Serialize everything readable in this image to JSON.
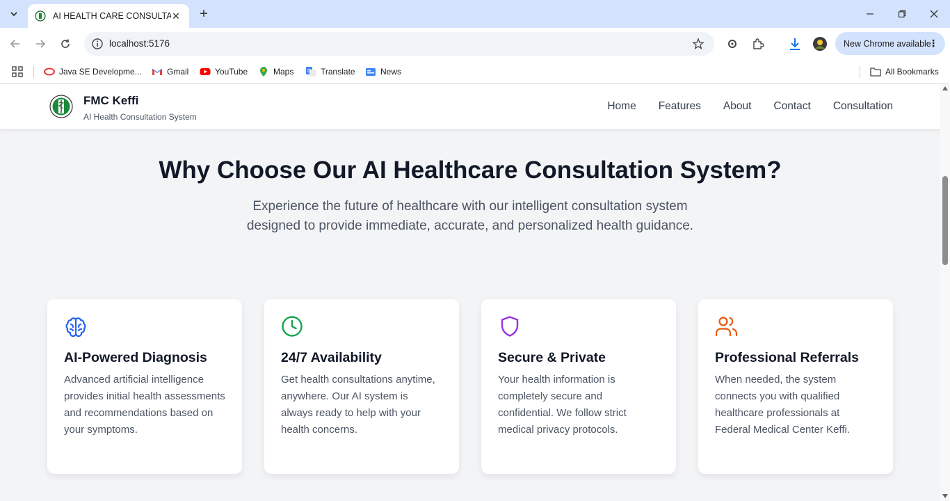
{
  "browser": {
    "tab_title": "AI HEALTH CARE CONSULTATIO",
    "url": "localhost:5176",
    "update_label": "New Chrome available",
    "bookmarks": [
      {
        "label": "Java SE Developme...",
        "icon": "oracle-icon"
      },
      {
        "label": "Gmail",
        "icon": "gmail-icon"
      },
      {
        "label": "YouTube",
        "icon": "youtube-icon"
      },
      {
        "label": "Maps",
        "icon": "maps-icon"
      },
      {
        "label": "Translate",
        "icon": "translate-icon"
      },
      {
        "label": "News",
        "icon": "news-icon"
      }
    ],
    "all_bookmarks": "All Bookmarks"
  },
  "header": {
    "brand": "FMC Keffi",
    "tagline": "AI Health Consultation System",
    "nav": [
      "Home",
      "Features",
      "About",
      "Contact",
      "Consultation"
    ]
  },
  "hero": {
    "title": "Why Choose Our AI Healthcare Consultation System?",
    "lead": "Experience the future of healthcare with our intelligent consultation system designed to provide immediate, accurate, and personalized health guidance."
  },
  "features": [
    {
      "title": "AI-Powered Diagnosis",
      "text": "Advanced artificial intelligence provides initial health assessments and recommendations based on your symptoms.",
      "icon": "brain-icon",
      "color": "#2563eb"
    },
    {
      "title": "24/7 Availability",
      "text": "Get health consultations anytime, anywhere. Our AI system is always ready to help with your health concerns.",
      "icon": "clock-icon",
      "color": "#16a34a"
    },
    {
      "title": "Secure & Private",
      "text": "Your health information is completely secure and confidential. We follow strict medical privacy protocols.",
      "icon": "shield-icon",
      "color": "#9333ea"
    },
    {
      "title": "Professional Referrals",
      "text": "When needed, the system connects you with qualified healthcare professionals at Federal Medical Center Keffi.",
      "icon": "users-icon",
      "color": "#ea580c"
    }
  ]
}
